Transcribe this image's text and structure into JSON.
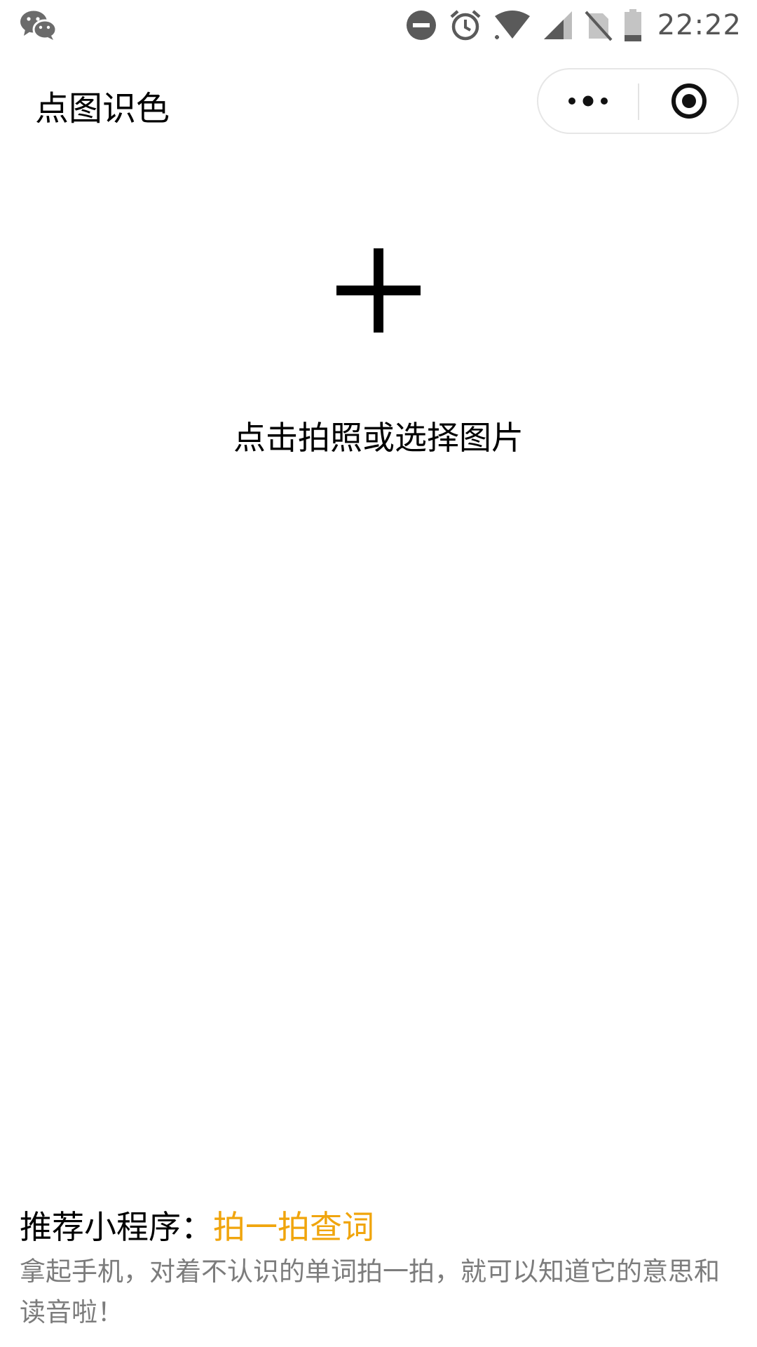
{
  "status_bar": {
    "time": "22:22",
    "icons": [
      "wechat-icon",
      "dnd-icon",
      "alarm-icon",
      "wifi-icon",
      "signal-icon",
      "no-sim-icon",
      "battery-icon"
    ]
  },
  "header": {
    "title": "点图识色",
    "menu_icons": [
      "more-dots-icon",
      "close-target-icon"
    ]
  },
  "upload": {
    "icon": "plus-icon",
    "label": "点击拍照或选择图片"
  },
  "recommend": {
    "prefix": "推荐小程序：",
    "app_name": "拍一拍查词",
    "description": "拿起手机，对着不认识的单词拍一拍，就可以知道它的意思和读音啦！"
  },
  "colors": {
    "accent": "#f0a50d",
    "text_primary": "#000000",
    "text_secondary": "#7c7c7c",
    "background": "#ffffff"
  }
}
